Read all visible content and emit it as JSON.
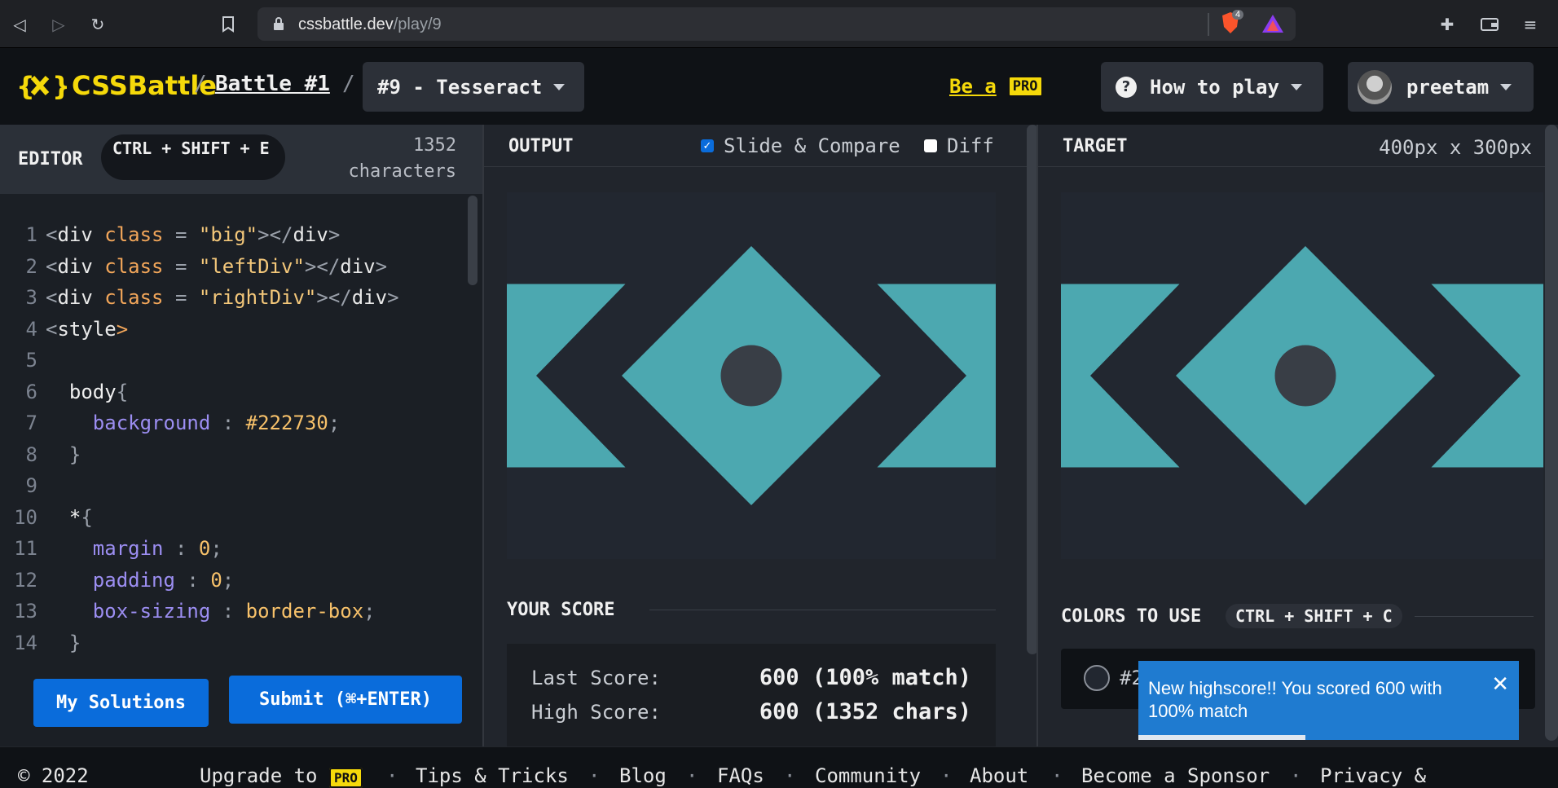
{
  "browser": {
    "url_host": "cssbattle.dev",
    "url_path": "/play/9",
    "brave_badge": "4",
    "icons": [
      "back-icon",
      "forward-icon",
      "reload-icon",
      "bookmark-icon",
      "lock-icon",
      "brave-shield-icon",
      "brave-rewards-icon",
      "extensions-icon",
      "wallet-icon",
      "menu-icon"
    ]
  },
  "header": {
    "logo": "CSSBattle",
    "sep1": "/",
    "battle": "Battle #1",
    "sep2": "/",
    "level": "#9 - Tesseract",
    "be_a": "Be a",
    "pro": "PRO",
    "how_to_play": "How to play",
    "user": "preetam"
  },
  "editor": {
    "title": "EDITOR",
    "shortcut": "CTRL + SHIFT + E",
    "chars_count": "1352",
    "chars_label": "characters",
    "my_solutions": "My Solutions",
    "submit": "Submit (⌘+ENTER)"
  },
  "code": [
    {
      "n": "1",
      "html": [
        "<",
        "div",
        " class",
        " = ",
        "\"big\"",
        "></",
        "div",
        ">"
      ]
    },
    {
      "n": "2",
      "html": [
        "<",
        "div",
        " class",
        " = ",
        "\"leftDiv\"",
        "></",
        "div",
        ">"
      ]
    },
    {
      "n": "3",
      "html": [
        "<",
        "div",
        " class",
        " = ",
        "\"rightDiv\"",
        "></",
        "div",
        ">"
      ]
    },
    {
      "n": "4",
      "html": [
        "<",
        "style",
        ">",
        "",
        "",
        "",
        "",
        ""
      ]
    }
  ],
  "css_lines": [
    {
      "n": "5",
      "indent": "",
      "sel": "",
      "prop": "",
      "val": "",
      "end": ""
    },
    {
      "n": "6",
      "indent": "  ",
      "sel": "body",
      "prop": "",
      "val": "",
      "end": "{"
    },
    {
      "n": "7",
      "indent": "    ",
      "sel": "",
      "prop": "background",
      "val": "#222730",
      "end": ";"
    },
    {
      "n": "8",
      "indent": "  ",
      "sel": "",
      "prop": "",
      "val": "",
      "end": "}"
    },
    {
      "n": "9",
      "indent": "",
      "sel": "",
      "prop": "",
      "val": "",
      "end": ""
    },
    {
      "n": "10",
      "indent": "  ",
      "sel": "*",
      "prop": "",
      "val": "",
      "end": "{"
    },
    {
      "n": "11",
      "indent": "    ",
      "sel": "",
      "prop": "margin",
      "val": "0",
      "end": ";"
    },
    {
      "n": "12",
      "indent": "    ",
      "sel": "",
      "prop": "padding",
      "val": "0",
      "end": ";"
    },
    {
      "n": "13",
      "indent": "    ",
      "sel": "",
      "prop": "box-sizing",
      "val": "border-box",
      "end": ";"
    },
    {
      "n": "14",
      "indent": "  ",
      "sel": "",
      "prop": "",
      "val": "",
      "end": "}"
    }
  ],
  "output": {
    "title": "OUTPUT",
    "slide_compare": "Slide & Compare",
    "slide_checked": true,
    "diff": "Diff",
    "diff_checked": false
  },
  "target": {
    "title": "TARGET",
    "size": "400px x 300px"
  },
  "score": {
    "title": "YOUR SCORE",
    "last_label": "Last Score:",
    "last_value": "600 (100% match)",
    "high_label": "High Score:",
    "high_value": "600 (1352 chars)"
  },
  "colors": {
    "title": "COLORS TO USE",
    "shortcut": "CTRL + SHIFT + C",
    "first_partial": "#2"
  },
  "toast": {
    "message": "New highscore!! You scored 600 with 100% match",
    "close": "✕"
  },
  "footer": {
    "copyright": "© 2022",
    "upgrade": "Upgrade to",
    "pro": "PRO",
    "tips": "Tips & Tricks",
    "blog": "Blog",
    "faqs": "FAQs",
    "community": "Community",
    "about": "About",
    "sponsor": "Become a Sponsor",
    "privacy": "Privacy &",
    "dot": "·"
  },
  "palette": {
    "bg": "#222730",
    "teal": "#4ca8b0",
    "circle": "#393e46"
  }
}
